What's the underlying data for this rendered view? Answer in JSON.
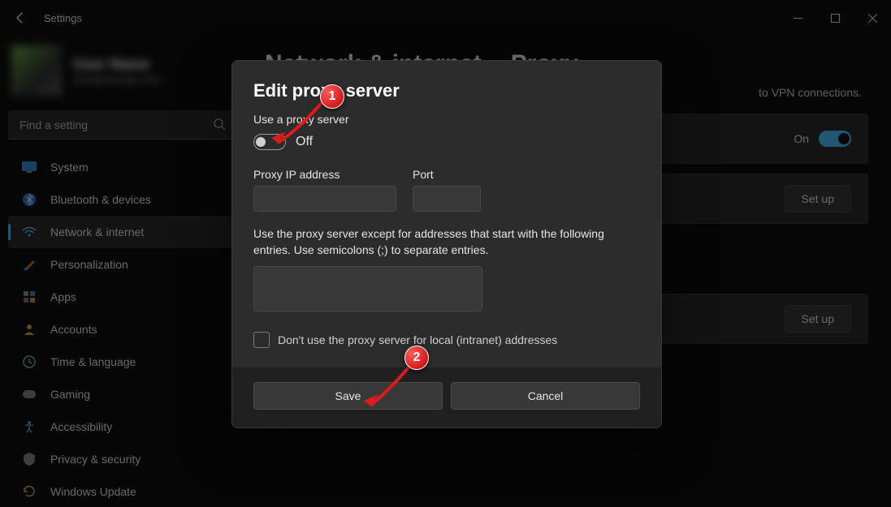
{
  "titlebar": {
    "title": "Settings"
  },
  "user": {
    "name": "User Name",
    "email": "user@example.com"
  },
  "search": {
    "placeholder": "Find a setting"
  },
  "sidebar": {
    "items": [
      {
        "label": "System"
      },
      {
        "label": "Bluetooth & devices"
      },
      {
        "label": "Network & internet"
      },
      {
        "label": "Personalization"
      },
      {
        "label": "Apps"
      },
      {
        "label": "Accounts"
      },
      {
        "label": "Time & language"
      },
      {
        "label": "Gaming"
      },
      {
        "label": "Accessibility"
      },
      {
        "label": "Privacy & security"
      },
      {
        "label": "Windows Update"
      }
    ]
  },
  "breadcrumb": {
    "parent": "Network & internet",
    "current": "Proxy"
  },
  "main": {
    "description_suffix": "to VPN connections.",
    "auto_toggle_state": "On",
    "setup_label": "Set up"
  },
  "dialog": {
    "title": "Edit proxy server",
    "use_proxy_label": "Use a proxy server",
    "toggle_state": "Off",
    "ip_label": "Proxy IP address",
    "port_label": "Port",
    "except_help": "Use the proxy server except for addresses that start with the following entries. Use semicolons (;) to separate entries.",
    "local_bypass_label": "Don't use the proxy server for local (intranet) addresses",
    "save_label": "Save",
    "cancel_label": "Cancel"
  },
  "annotations": {
    "marker1": "1",
    "marker2": "2"
  }
}
